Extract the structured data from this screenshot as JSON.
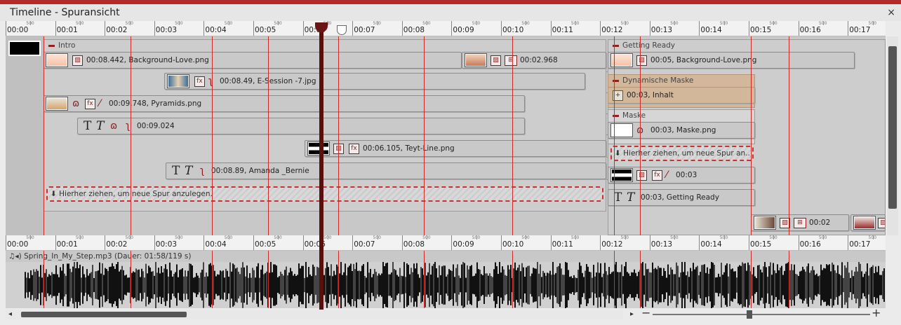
{
  "window": {
    "title": "Timeline - Spuransicht",
    "close_glyph": "×"
  },
  "ruler": {
    "labels": [
      "00:00",
      "00:01",
      "00:02",
      "00:03",
      "00:04",
      "00:05",
      "00:06",
      "00:07",
      "00:08",
      "00:09",
      "00:10",
      "00:11",
      "00:12",
      "00:13",
      "00:14",
      "00:15",
      "00:16",
      "00:17"
    ],
    "sub_label": "500"
  },
  "tracks": {
    "groups": {
      "intro": "Intro",
      "getting_ready": "Getting Ready",
      "dynamische_maske": "Dynamische Maske",
      "maske": "Maske"
    },
    "clips": {
      "background_love_1": "00:08.442, Background-Love.png",
      "heart_clip": "00:02.968",
      "e_session": "00:08.49, E-Session -7.jpg",
      "pyramids": "00:09.748, Pyramids.png",
      "text_1": "00:09.024",
      "teyt_line": "00:06.105, Teyt-Line.png",
      "amanda": "00:08.89, Amanda _Bernie",
      "background_love_2": "00:05, Background-Love.png",
      "inhalt": "00:03, Inhalt",
      "maske_png": "00:03, Maske.png",
      "black_clip": "00:03",
      "getting_ready_text": "00:03, Getting Ready",
      "photo_clip": "00:02"
    },
    "dropzones": {
      "main": "Hierher ziehen, um neue Spur anzulegen.",
      "right": "Hierher ziehen, um neue Spur an..."
    }
  },
  "audio": {
    "label": "Spring_In_My_Step.mp3 (Dauer: 01:58/119 s)"
  },
  "controls": {
    "zoom_out": "−",
    "zoom_in": "+"
  },
  "colors": {
    "accent": "#b22a2a",
    "marker": "#d12a2a",
    "playhead": "#5a0f0f",
    "mask_group": "#d3b79a"
  },
  "icons": [
    "close-icon",
    "fx-icon",
    "curve-icon",
    "text-icon",
    "brush-icon",
    "sound-icon",
    "slideshow-icon"
  ]
}
